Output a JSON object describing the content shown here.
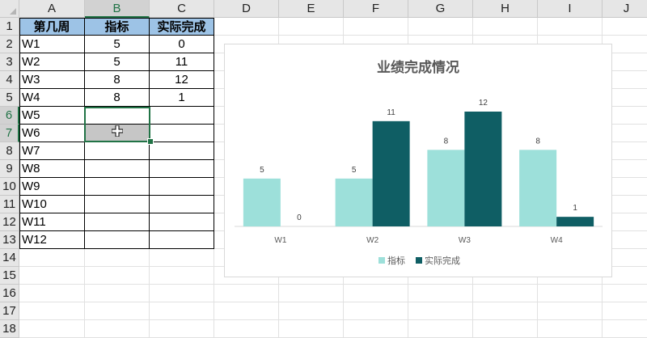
{
  "sheet": {
    "columns": [
      "A",
      "B",
      "C",
      "D",
      "E",
      "F",
      "G",
      "H",
      "I",
      "J"
    ],
    "rows": [
      "1",
      "2",
      "3",
      "4",
      "5",
      "6",
      "7",
      "8",
      "9",
      "10",
      "11",
      "12",
      "13",
      "14",
      "15",
      "16",
      "17",
      "18"
    ],
    "active_column": "B",
    "active_rows": [
      "6",
      "7"
    ]
  },
  "table": {
    "headers": [
      "第几周",
      "指标",
      "实际完成"
    ],
    "rows": [
      [
        "W1",
        "5",
        "0"
      ],
      [
        "W2",
        "5",
        "11"
      ],
      [
        "W3",
        "8",
        "12"
      ],
      [
        "W4",
        "8",
        "1"
      ],
      [
        "W5",
        "",
        ""
      ],
      [
        "W6",
        "",
        ""
      ],
      [
        "W7",
        "",
        ""
      ],
      [
        "W8",
        "",
        ""
      ],
      [
        "W9",
        "",
        ""
      ],
      [
        "W10",
        "",
        ""
      ],
      [
        "W11",
        "",
        ""
      ],
      [
        "W12",
        "",
        ""
      ]
    ]
  },
  "colors": {
    "header_fill": "#9dc3e6",
    "series_1": "#9de0da",
    "series_2": "#0f5e64",
    "selection": "#217346"
  },
  "chart_data": {
    "type": "bar",
    "title": "业绩完成情况",
    "categories": [
      "W1",
      "W2",
      "W3",
      "W4"
    ],
    "series": [
      {
        "name": "指标",
        "values": [
          5,
          5,
          8,
          8
        ]
      },
      {
        "name": "实际完成",
        "values": [
          0,
          11,
          12,
          1
        ]
      }
    ],
    "ylim": [
      0,
      14
    ],
    "grid": false,
    "legend": "bottom",
    "data_labels": true
  }
}
